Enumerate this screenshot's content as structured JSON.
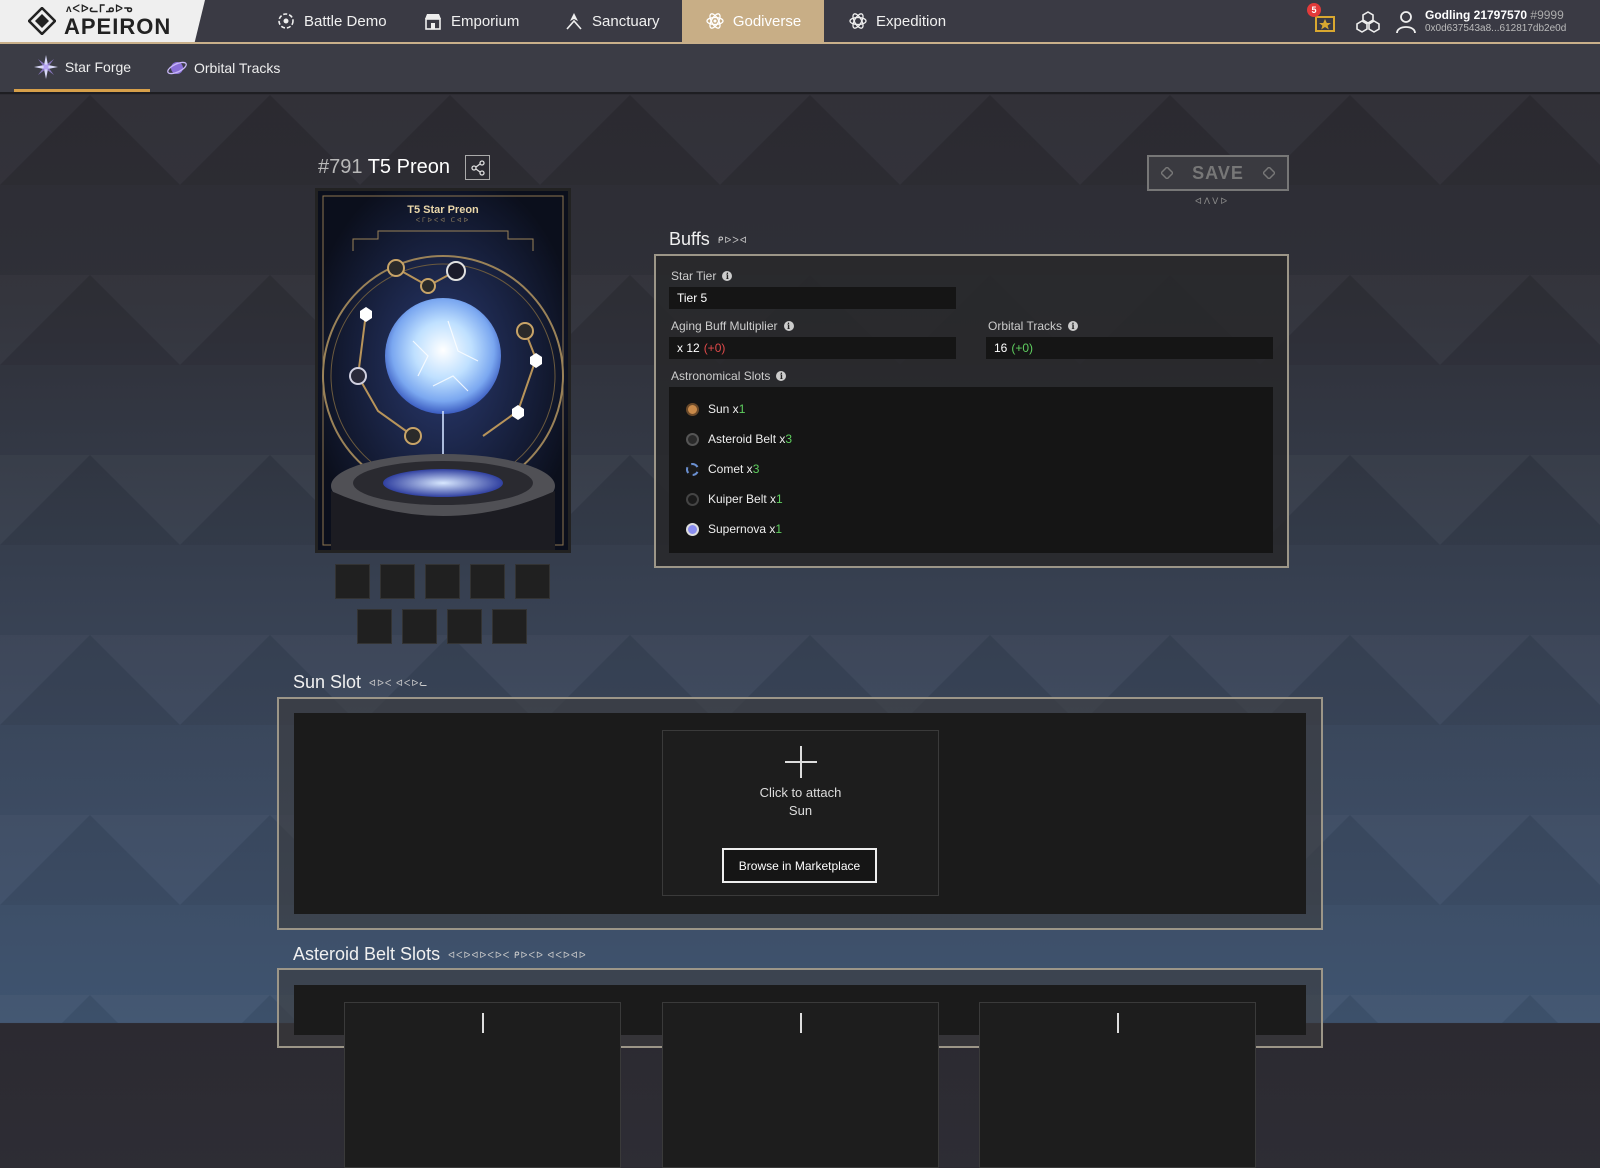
{
  "app": {
    "logo_sub": "ᴧᐸᐅᓚᒥᓄᐅᓀ",
    "logo_name": "APEIRON"
  },
  "nav": {
    "items": [
      {
        "label": "Battle Demo",
        "icon": "battle-icon"
      },
      {
        "label": "Emporium",
        "icon": "store-icon"
      },
      {
        "label": "Sanctuary",
        "icon": "sanctuary-icon"
      },
      {
        "label": "Godiverse",
        "icon": "atom-icon",
        "active": true
      },
      {
        "label": "Expedition",
        "icon": "expedition-icon"
      }
    ]
  },
  "user": {
    "notification_count": "5",
    "name": "Godling 21797570",
    "tag": "#9999",
    "address": "0x0d637543a8...612817db2e0d"
  },
  "subnav": {
    "items": [
      {
        "label": "Star Forge",
        "icon": "star-forge-icon",
        "active": true
      },
      {
        "label": "Orbital Tracks",
        "icon": "orbital-tracks-icon"
      }
    ]
  },
  "card": {
    "number": "#791",
    "name": "T5 Preon",
    "label": "T5 Star Preon",
    "sublabel": "ᐸᒥᐅᐸᐊ ᑕᐊᐅ"
  },
  "save": {
    "label": "SAVE",
    "rune": "ᐊᐱᐯᐅ"
  },
  "buffs": {
    "title": "Buffs",
    "rune": "ᑭᐅᐳᐊ",
    "star_tier": {
      "label": "Star Tier",
      "value": "Tier 5"
    },
    "aging": {
      "label": "Aging Buff Multiplier",
      "value": "x 12",
      "delta": "(+0)"
    },
    "orbital": {
      "label": "Orbital Tracks",
      "value": "16",
      "delta": "(+0)"
    },
    "astro_label": "Astronomical Slots",
    "astro": [
      {
        "name": "Sun x",
        "count": "1",
        "color": "#c98a4a"
      },
      {
        "name": "Asteroid Belt x",
        "count": "3",
        "color": "#555"
      },
      {
        "name": "Comet x",
        "count": "3",
        "color": "#6a8fd0"
      },
      {
        "name": "Kuiper Belt x",
        "count": "1",
        "color": "#444"
      },
      {
        "name": "Supernova x",
        "count": "1",
        "color": "#8a8ef0"
      }
    ]
  },
  "sun_slot": {
    "title": "Sun Slot",
    "rune": "ᐊᐅᐸ ᐊᐸᐅᓚ",
    "attach_line1": "Click to attach",
    "attach_line2": "Sun",
    "browse": "Browse in Marketplace"
  },
  "asteroid_slot": {
    "title": "Asteroid Belt Slots",
    "rune": "ᐊᐸᐅᐊᐅᐸᐅᐸ ᑭᐅᐸᐅ ᐊᐸᐅᐊᐅ"
  }
}
